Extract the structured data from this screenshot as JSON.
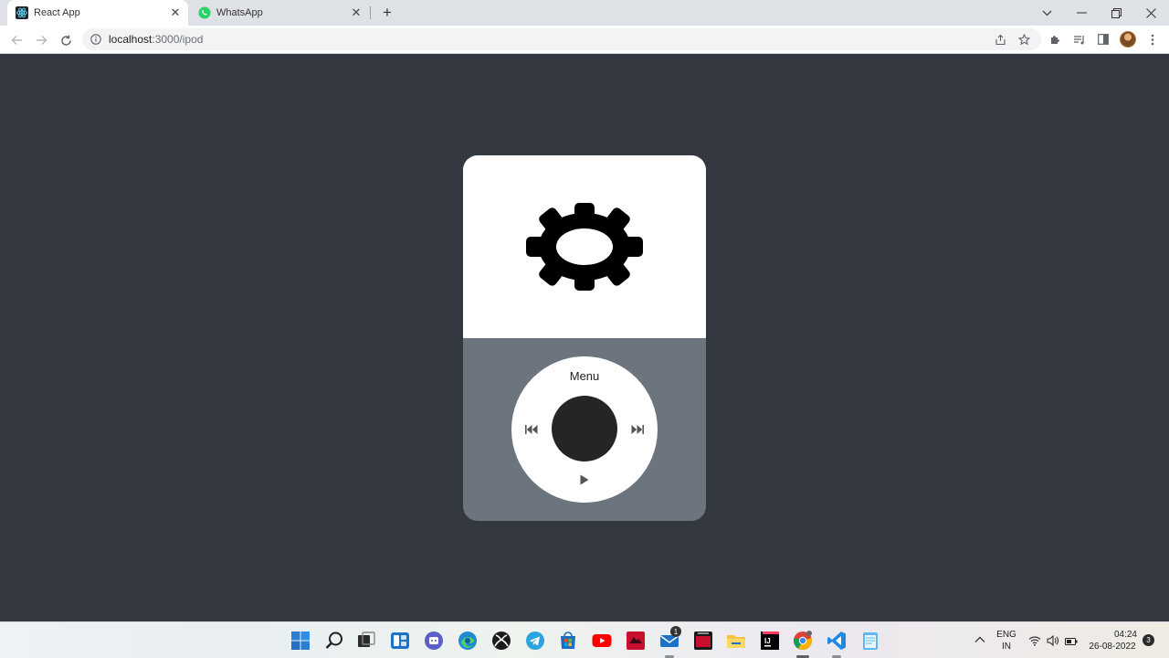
{
  "browser": {
    "tabs": [
      {
        "title": "React App",
        "active": true
      },
      {
        "title": "WhatsApp",
        "active": false
      }
    ],
    "url_host": "localhost",
    "url_rest": ":3000/ipod"
  },
  "ipod": {
    "screen_icon": "gear-icon",
    "wheel": {
      "menu_label": "Menu",
      "left_icon": "rewind-icon",
      "right_icon": "fast-forward-icon",
      "bottom_icon": "play-icon"
    }
  },
  "taskbar": {
    "apps": [
      "windows-start-icon",
      "search-icon",
      "task-view-icon",
      "widgets-icon",
      "teams-chat-icon",
      "edge-icon",
      "xbox-icon",
      "telegram-icon",
      "microsoft-store-icon",
      "youtube-icon",
      "app-red-icon",
      "mail-icon",
      "terminal-red-icon",
      "file-explorer-icon",
      "intellij-icon",
      "chrome-icon",
      "vscode-icon",
      "notepad-icon"
    ],
    "mail_badge": "1",
    "lang_line1": "ENG",
    "lang_line2": "IN",
    "time": "04:24",
    "date": "26-08-2022",
    "notifications": "3"
  },
  "colors": {
    "page_bg": "#343841",
    "ipod_body": "#6c757d",
    "center_button": "#232527"
  }
}
